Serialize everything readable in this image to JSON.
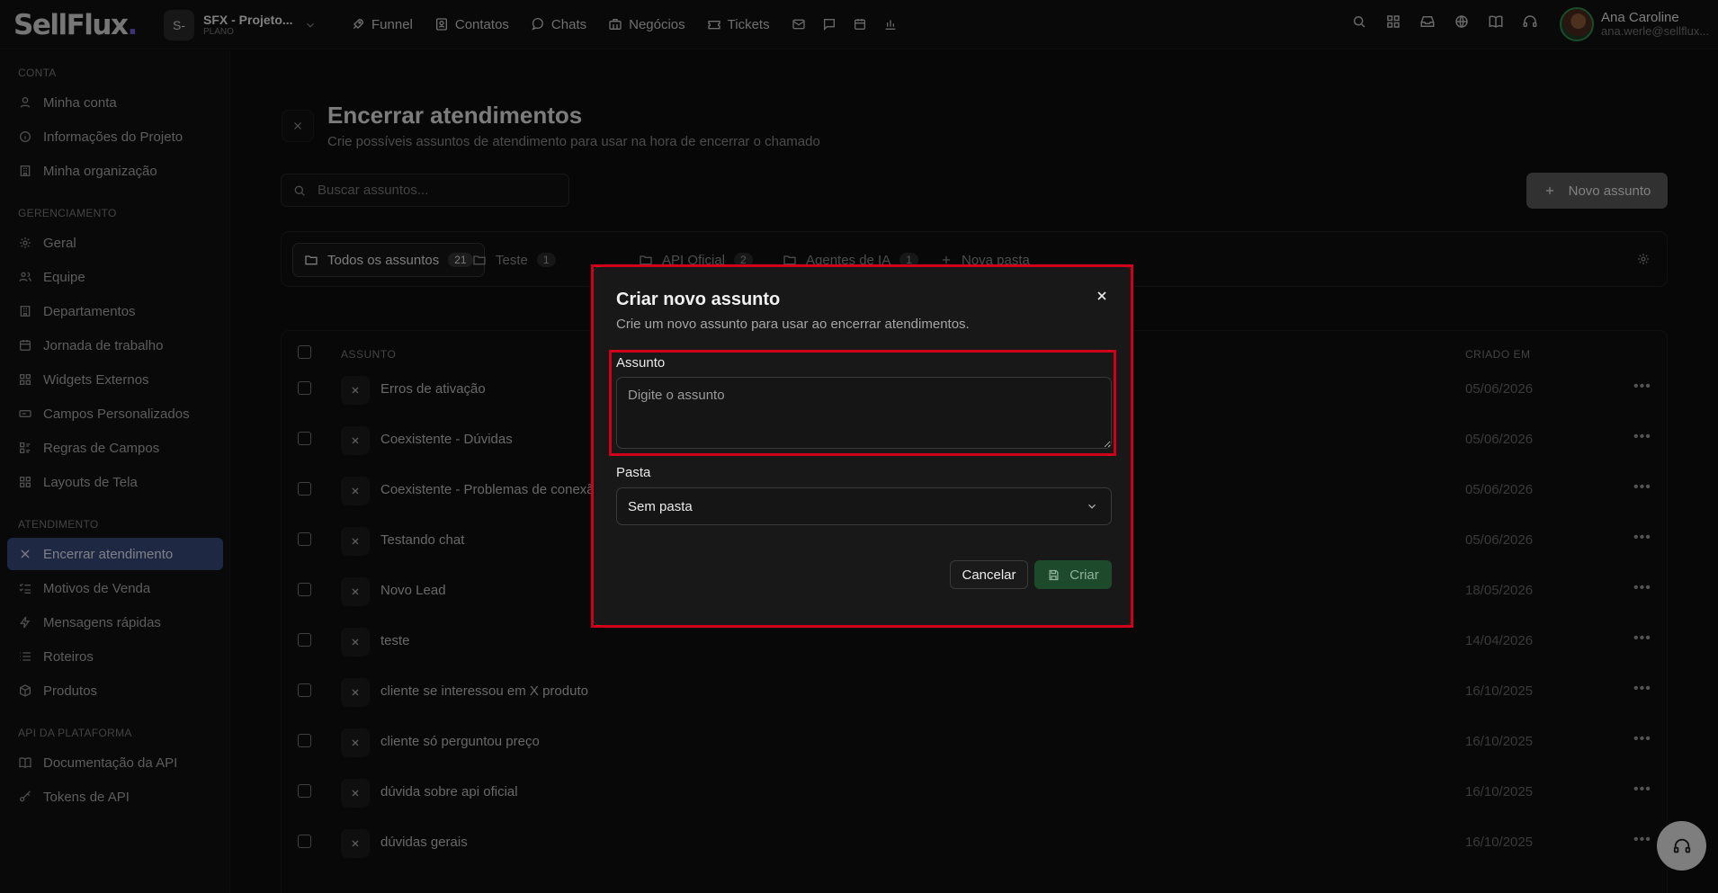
{
  "app": {
    "logo_text": "SellFlux",
    "logo_dot": "."
  },
  "project": {
    "avatar": "S-",
    "name": "SFX - Projeto...",
    "plan": "PLANO"
  },
  "nav": [
    {
      "label": "Funnel",
      "icon": "rocket-icon"
    },
    {
      "label": "Contatos",
      "icon": "contacts-icon"
    },
    {
      "label": "Chats",
      "icon": "chat-bubble-icon"
    },
    {
      "label": "Negócios",
      "icon": "briefcase-icon"
    },
    {
      "label": "Tickets",
      "icon": "ticket-icon"
    }
  ],
  "nav_icons": [
    "mail-icon",
    "message-square-icon",
    "calendar-icon",
    "bar-chart-icon"
  ],
  "tools": [
    "search-icon",
    "grid-icon",
    "inbox-icon",
    "globe-icon",
    "book-icon",
    "headset-icon"
  ],
  "user": {
    "name": "Ana Caroline",
    "email": "ana.werle@sellflux..."
  },
  "sidebar": {
    "sections": [
      {
        "title": "CONTA",
        "items": [
          {
            "label": "Minha conta",
            "icon": "user-icon"
          },
          {
            "label": "Informações do Projeto",
            "icon": "info-icon"
          },
          {
            "label": "Minha organização",
            "icon": "building-icon"
          }
        ]
      },
      {
        "title": "GERENCIAMENTO",
        "items": [
          {
            "label": "Geral",
            "icon": "gear-icon"
          },
          {
            "label": "Equipe",
            "icon": "users-icon"
          },
          {
            "label": "Departamentos",
            "icon": "building-icon"
          },
          {
            "label": "Jornada de trabalho",
            "icon": "calendar-icon"
          },
          {
            "label": "Widgets Externos",
            "icon": "widgets-icon"
          },
          {
            "label": "Campos Personalizados",
            "icon": "input-field-icon"
          },
          {
            "label": "Regras de Campos",
            "icon": "rules-icon"
          },
          {
            "label": "Layouts de Tela",
            "icon": "layout-icon"
          }
        ]
      },
      {
        "title": "ATENDIMENTO",
        "items": [
          {
            "label": "Encerrar atendimento",
            "icon": "close-icon",
            "active": true
          },
          {
            "label": "Motivos de Venda",
            "icon": "list-check-icon"
          },
          {
            "label": "Mensagens rápidas",
            "icon": "lightning-icon"
          },
          {
            "label": "Roteiros",
            "icon": "list-icon"
          },
          {
            "label": "Produtos",
            "icon": "package-icon"
          }
        ]
      },
      {
        "title": "API DA PLATAFORMA",
        "items": [
          {
            "label": "Documentação da API",
            "icon": "book-icon"
          },
          {
            "label": "Tokens de API",
            "icon": "key-icon"
          }
        ]
      }
    ]
  },
  "page": {
    "title": "Encerrar atendimentos",
    "subtitle": "Crie possíveis assuntos de atendimento para usar na hora de encerrar o chamado",
    "search_placeholder": "Buscar assuntos...",
    "new_button": "Novo assunto"
  },
  "folders": [
    {
      "label": "Todos os assuntos",
      "count": "21",
      "active": true
    },
    {
      "label": "Teste",
      "count": "1"
    },
    {
      "label": "API Oficial",
      "count": "2"
    },
    {
      "label": "Agentes de IA",
      "count": "1"
    }
  ],
  "new_folder": "Nova pasta",
  "table": {
    "col_subject": "ASSUNTO",
    "col_created": "CRIADO EM",
    "rows": [
      {
        "name": "Erros de ativação",
        "date": "05/06/2026"
      },
      {
        "name": "Coexistente - Dúvidas",
        "date": "05/06/2026"
      },
      {
        "name": "Coexistente - Problemas de conexão",
        "date": "05/06/2026"
      },
      {
        "name": "Testando chat",
        "date": "05/06/2026"
      },
      {
        "name": "Novo Lead",
        "date": "18/05/2026"
      },
      {
        "name": "teste",
        "date": "14/04/2026"
      },
      {
        "name": "cliente se interessou em X produto",
        "date": "16/10/2025"
      },
      {
        "name": "cliente só perguntou preço",
        "date": "16/10/2025"
      },
      {
        "name": "dúvida sobre api oficial",
        "date": "16/10/2025"
      },
      {
        "name": "dúvidas gerais",
        "date": "16/10/2025"
      }
    ]
  },
  "modal": {
    "title": "Criar novo assunto",
    "description": "Crie um novo assunto para usar ao encerrar atendimentos.",
    "subject_label": "Assunto",
    "subject_placeholder": "Digite o assunto",
    "subject_value": "",
    "folder_label": "Pasta",
    "folder_value": "Sem pasta",
    "cancel": "Cancelar",
    "create": "Criar"
  },
  "colors": {
    "accent_active": "#38497a",
    "create_button": "#1d4a2a",
    "highlight_outline": "#d0001a"
  }
}
